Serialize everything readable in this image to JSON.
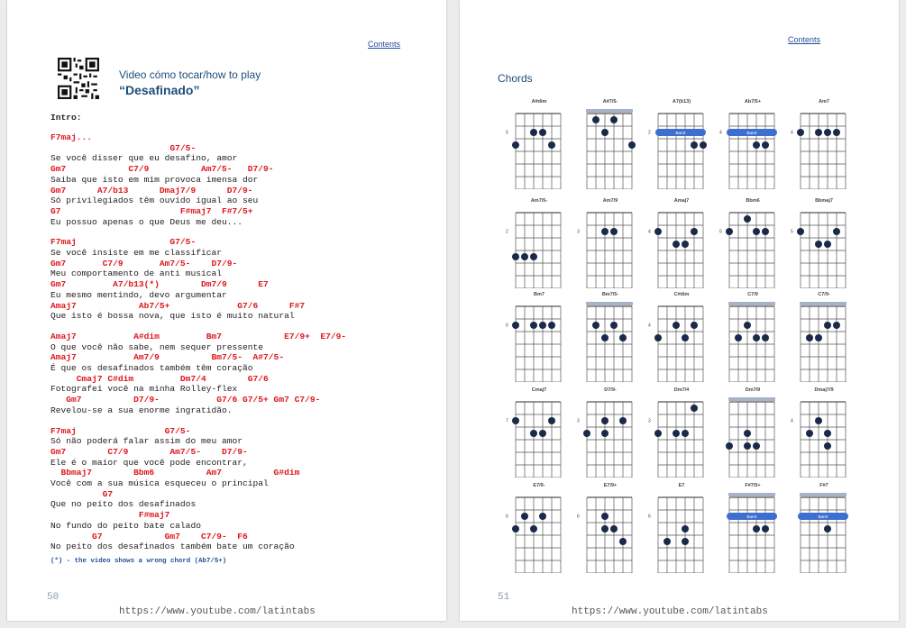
{
  "left_page": {
    "contents_link": "Contents",
    "video_line1": "Video cómo tocar/how to play",
    "video_line2": "“Desafinado”",
    "intro": "Intro:",
    "lines": [
      {
        "t": "c",
        "text": "F7maj..."
      },
      {
        "t": "c",
        "text": "                       G7/5-"
      },
      {
        "t": "l",
        "text": "Se você disser que eu desafino, amor"
      },
      {
        "t": "c",
        "text": "Gm7            C7/9          Am7/5-   D7/9-"
      },
      {
        "t": "l",
        "text": "Saiba que isto em mim provoca imensa dor"
      },
      {
        "t": "c",
        "text": "Gm7      A7/b13      Dmaj7/9      D7/9-"
      },
      {
        "t": "l",
        "text": "Só privilegiados têm ouvido igual ao seu"
      },
      {
        "t": "c",
        "text": "G7                       F#maj7  F#7/5+"
      },
      {
        "t": "l",
        "text": "Eu possuo apenas o que Deus me deu..."
      },
      {
        "t": "b",
        "text": ""
      },
      {
        "t": "c",
        "text": "F7maj                  G7/5-"
      },
      {
        "t": "l",
        "text": "Se você insiste em me classificar"
      },
      {
        "t": "c",
        "text": "Gm7       C7/9       Am7/5-    D7/9-"
      },
      {
        "t": "l",
        "text": "Meu comportamento de anti musical"
      },
      {
        "t": "c",
        "text": "Gm7         A7/b13(*)        Dm7/9      E7"
      },
      {
        "t": "l",
        "text": "Eu mesmo mentindo, devo argumentar"
      },
      {
        "t": "c",
        "text": "Amaj7            Ab7/5+             G7/6      F#7"
      },
      {
        "t": "l",
        "text": "Que isto é bossa nova, que isto é muito natural"
      },
      {
        "t": "b",
        "text": ""
      },
      {
        "t": "c",
        "text": "Amaj7           A#dim         Bm7            E7/9+  E7/9-"
      },
      {
        "t": "l",
        "text": "O que você não sabe, nem sequer pressente"
      },
      {
        "t": "c",
        "text": "Amaj7           Am7/9          Bm7/5-  A#7/5-"
      },
      {
        "t": "l",
        "text": "É que os desafinados também têm coração"
      },
      {
        "t": "c",
        "text": "     Cmaj7 C#dim         Dm7/4        G7/6"
      },
      {
        "t": "l",
        "text": "Fotografei você na minha Rolley-flex"
      },
      {
        "t": "c",
        "text": "   Gm7          D7/9-           G7/6 G7/5+ Gm7 C7/9-"
      },
      {
        "t": "l",
        "text": "Revelou-se a sua enorme ingratidão."
      },
      {
        "t": "b",
        "text": ""
      },
      {
        "t": "c",
        "text": "F7maj                 G7/5-"
      },
      {
        "t": "l",
        "text": "Só não poderá falar assim do meu amor"
      },
      {
        "t": "c",
        "text": "Gm7        C7/9        Am7/5-    D7/9-"
      },
      {
        "t": "l",
        "text": "Ele é o maior que você pode encontrar,"
      },
      {
        "t": "c",
        "text": "  Bbmaj7        Bbm6          Am7          G#dim"
      },
      {
        "t": "l",
        "text": "Você com a sua música esqueceu o principal"
      },
      {
        "t": "c",
        "text": "          G7"
      },
      {
        "t": "l",
        "text": "Que no peito dos desafinados"
      },
      {
        "t": "c",
        "text": "                 F#maj7"
      },
      {
        "t": "l",
        "text": "No fundo do peito bate calado"
      },
      {
        "t": "c",
        "text": "        G7            Gm7    C7/9-  F6"
      },
      {
        "t": "l",
        "text": "No peito dos desafinados também bate um coração"
      }
    ],
    "note": "(*) - the video shows a wrong chord (Ab7/5+)",
    "page_number": "50",
    "footer_url": "https://www.youtube.com/latintabs"
  },
  "right_page": {
    "contents_link": "Contents",
    "heading": "Chords",
    "diagrams": [
      {
        "name": "A#dim"
      },
      {
        "name": "A#7/5-"
      },
      {
        "name": "A7(b13)"
      },
      {
        "name": "Ab7/5+"
      },
      {
        "name": "Am7"
      },
      {
        "name": "Am7/5-"
      },
      {
        "name": "Am7/9"
      },
      {
        "name": "Amaj7"
      },
      {
        "name": "Bbm6"
      },
      {
        "name": "Bbmaj7"
      },
      {
        "name": "Bm7"
      },
      {
        "name": "Bm7/5-"
      },
      {
        "name": "C#dim"
      },
      {
        "name": "C7/9"
      },
      {
        "name": "C7/9-"
      },
      {
        "name": "Cmaj7"
      },
      {
        "name": "D7/9-"
      },
      {
        "name": "Dm7/4"
      },
      {
        "name": "Dm7/9"
      },
      {
        "name": "Dmaj7/9"
      },
      {
        "name": "E7/9-"
      },
      {
        "name": "E7/9+"
      },
      {
        "name": "E7"
      },
      {
        "name": "F#7/5+"
      },
      {
        "name": "F#7"
      }
    ],
    "page_number": "51",
    "footer_url": "https://www.youtube.com/latintabs"
  },
  "colors": {
    "chord_red": "#e0161c",
    "link_blue": "#1f4e9a",
    "heading_blue": "#1f4e79",
    "dot_navy": "#1b2a4a",
    "barre_blue": "#3d6fd0"
  }
}
